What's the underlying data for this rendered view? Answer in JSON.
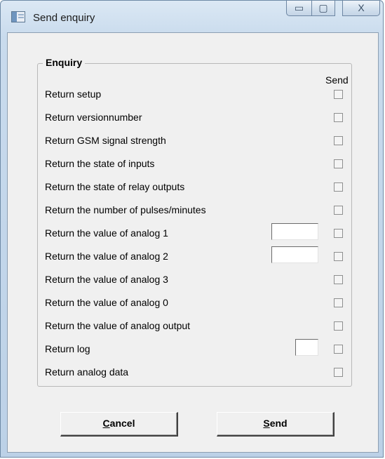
{
  "window": {
    "title": "Send enquiry"
  },
  "controls": {
    "minimize": "▭",
    "maximize": "▢",
    "close": "X"
  },
  "enquiry": {
    "group_title": "Enquiry",
    "send_header": "Send",
    "rows": [
      {
        "label": "Return setup",
        "checked": false
      },
      {
        "label": "Return versionnumber",
        "checked": false
      },
      {
        "label": "Return GSM signal strength",
        "checked": false
      },
      {
        "label": "Return the state of inputs",
        "checked": false
      },
      {
        "label": "Return the state of relay outputs",
        "checked": false
      },
      {
        "label": "Return the number of pulses/minutes",
        "checked": false
      },
      {
        "label": "Return the value of analog 1",
        "checked": false,
        "input_value": ""
      },
      {
        "label": "Return the value of analog 2",
        "checked": false,
        "input_value": ""
      },
      {
        "label": "Return the value of analog 3",
        "checked": false
      },
      {
        "label": "Return the value of analog 0",
        "checked": false
      },
      {
        "label": "Return the value of analog output",
        "checked": false
      },
      {
        "label": "Return log",
        "checked": false,
        "input_value": ""
      },
      {
        "label": "Return analog data",
        "checked": false
      }
    ]
  },
  "buttons": {
    "cancel": {
      "mnemonic": "C",
      "rest": "ancel"
    },
    "send": {
      "mnemonic": "S",
      "rest": "end"
    }
  }
}
